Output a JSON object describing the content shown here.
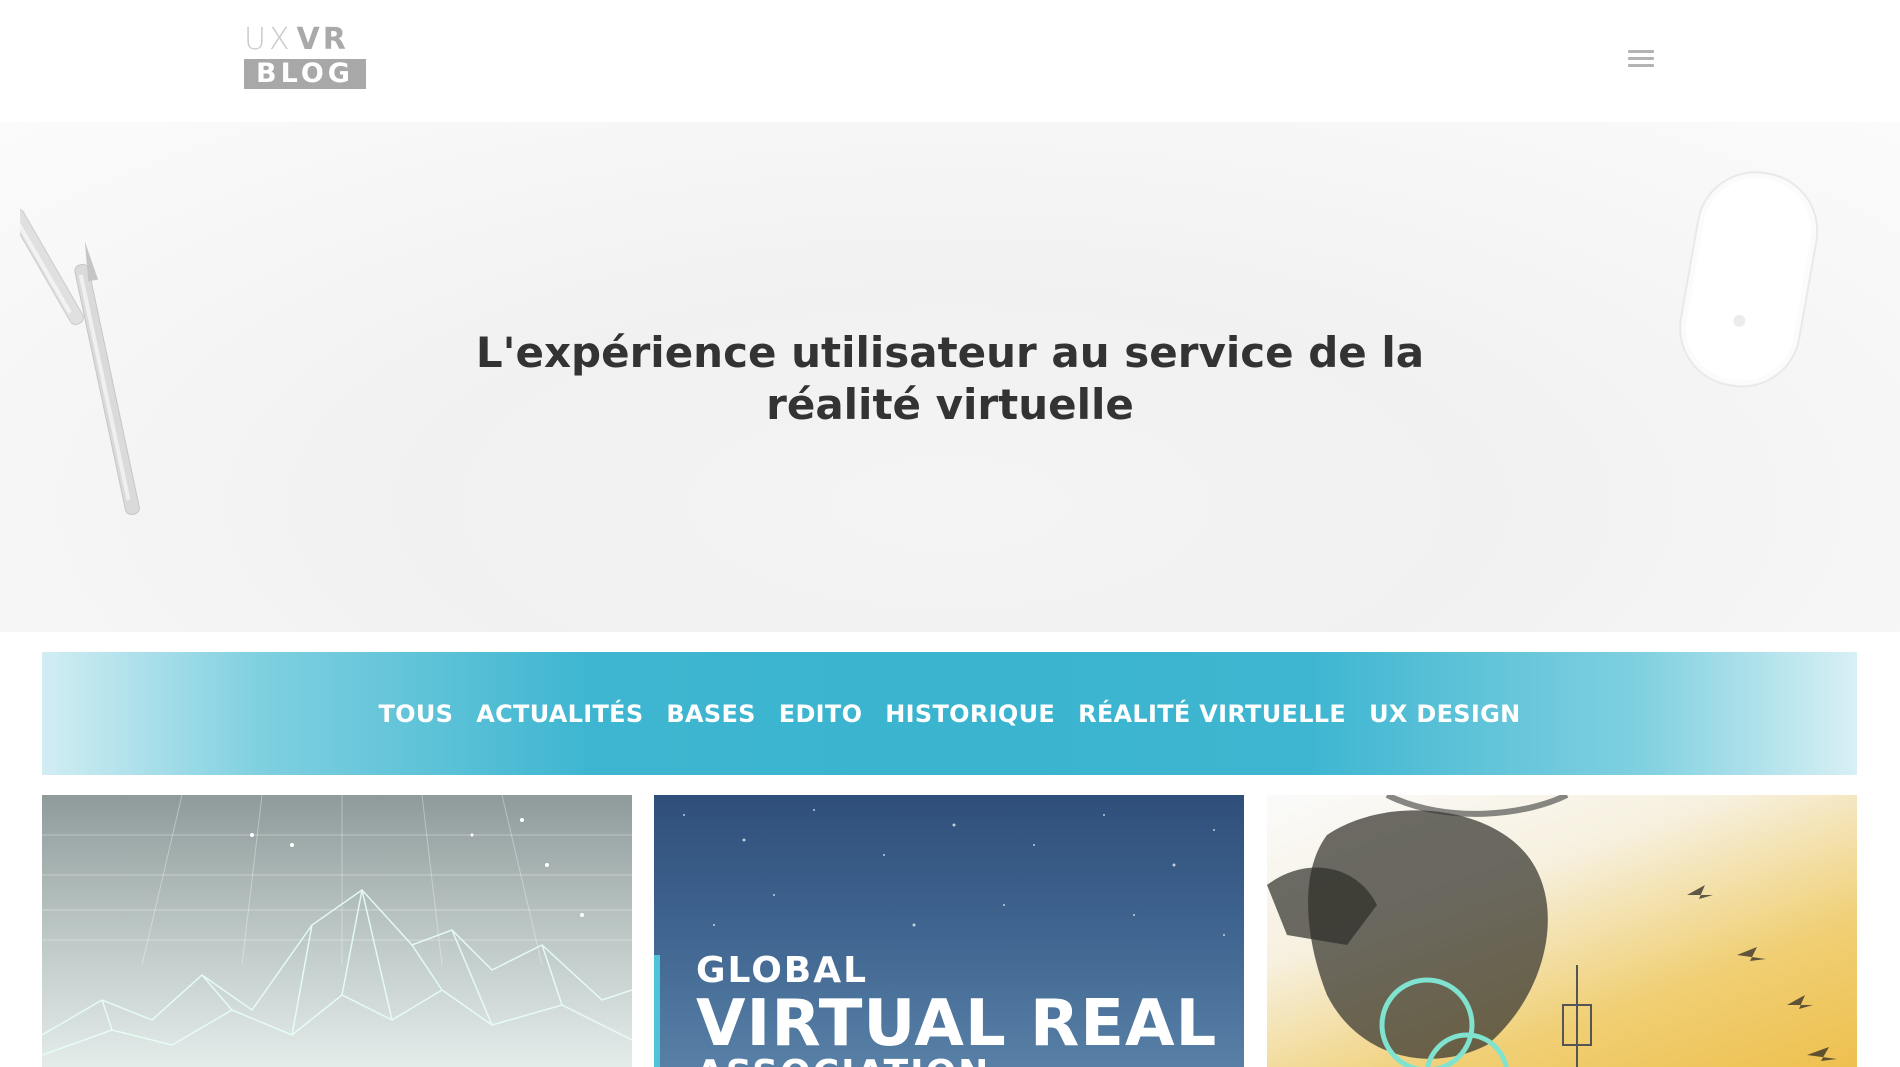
{
  "header": {
    "logo": {
      "top_left": "UX",
      "top_right": "VR",
      "bottom": "BLOG"
    },
    "menu_icon": "hamburger-menu-icon"
  },
  "hero": {
    "title": "L'expérience utilisateur au service de la réalité virtuelle"
  },
  "categories": {
    "items": [
      {
        "label": "TOUS"
      },
      {
        "label": "ACTUALITÉS"
      },
      {
        "label": "BASES"
      },
      {
        "label": "EDITO"
      },
      {
        "label": "HISTORIQUE"
      },
      {
        "label": "RÉALITÉ VIRTUELLE"
      },
      {
        "label": "UX DESIGN"
      }
    ]
  },
  "posts": [
    {
      "image": "wireframe-mountains-image"
    },
    {
      "image": "gvra-logo-image",
      "line1": "GLOBAL",
      "line2": "VIRTUAL REAL",
      "line3": "ASSOCIATION"
    },
    {
      "image": "vr-illustration-image"
    }
  ],
  "colors": {
    "accent": "#3ab4cf",
    "title": "#333333",
    "logo_gray": "#a8a8a8"
  }
}
